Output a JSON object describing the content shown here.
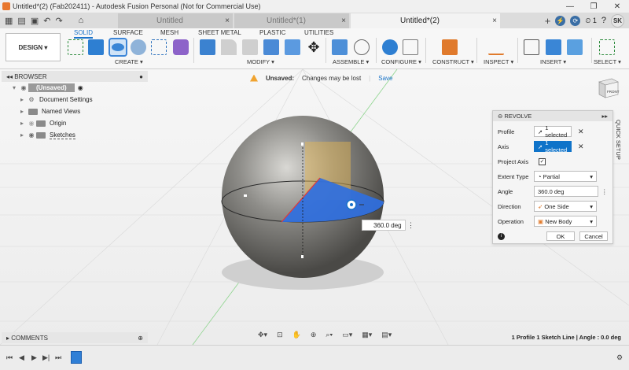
{
  "window": {
    "title": "Untitled*(2) (Fab202411) - Autodesk Fusion Personal (Not for Commercial Use)",
    "controls": [
      "—",
      "❐",
      "✕"
    ]
  },
  "tabs": [
    {
      "label": "Untitled",
      "active": false
    },
    {
      "label": "Untitled*(1)",
      "active": false
    },
    {
      "label": "Untitled*(2)",
      "active": true
    }
  ],
  "topbar": {
    "notifications": "1",
    "user_initials": "SK"
  },
  "ribbon": {
    "workspace": "DESIGN ▾",
    "tabs": [
      "SOLID",
      "SURFACE",
      "MESH",
      "SHEET METAL",
      "PLASTIC",
      "UTILITIES"
    ],
    "groups": [
      "CREATE ▾",
      "MODIFY ▾",
      "ASSEMBLE ▾",
      "CONFIGURE ▾",
      "CONSTRUCT ▾",
      "INSPECT ▾",
      "INSERT ▾",
      "SELECT ▾"
    ]
  },
  "browser": {
    "title": "BROWSER",
    "root": "(Unsaved)",
    "items": [
      "Document Settings",
      "Named Views",
      "Origin",
      "Sketches"
    ]
  },
  "unsaved_banner": {
    "label": "Unsaved:",
    "message": "Changes may be lost",
    "action": "Save"
  },
  "viewcube": {
    "face": "FRONT"
  },
  "dialog": {
    "title": "REVOLVE",
    "profile_label": "Profile",
    "profile_value": "1 selected",
    "axis_label": "Axis",
    "axis_value": "1 selected",
    "project_axis_label": "Project Axis",
    "project_axis_checked": true,
    "extent_type_label": "Extent Type",
    "extent_type_value": "Partial",
    "angle_label": "Angle",
    "angle_value": "360.0 deg",
    "direction_label": "Direction",
    "direction_value": "One Side",
    "operation_label": "Operation",
    "operation_value": "New Body",
    "ok_label": "OK",
    "cancel_label": "Cancel"
  },
  "quick_setup": "QUICK SETUP",
  "manipulator": {
    "angle_value": "360.0 deg"
  },
  "comments": {
    "title": "COMMENTS"
  },
  "status": "1 Profile 1 Sketch Line | Angle : 0.0 deg",
  "colors": {
    "accent": "#1a73c9",
    "profile_fill": "#2f6fe0",
    "sphere": "#6e6d6a"
  }
}
